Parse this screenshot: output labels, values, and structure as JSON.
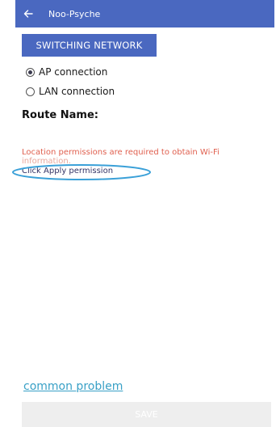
{
  "app_bar": {
    "title": "Noo-Psyche",
    "back_icon": "arrow-left-icon",
    "color": "#4a68c0"
  },
  "switch_button": {
    "label": "SWITCHING NETWORK"
  },
  "connection_options": [
    {
      "label": "AP connection",
      "selected": true
    },
    {
      "label": "LAN connection",
      "selected": false
    }
  ],
  "route": {
    "label": "Route Name:"
  },
  "permission": {
    "message_line1": "Location permissions are required to obtain Wi-Fi",
    "message_line2": "information.",
    "link": "Click Apply permission",
    "message_color": "#e0604f",
    "highlight_color": "#3aa0d8"
  },
  "common_problem": {
    "label": "common problem",
    "color": "#38a0c6"
  },
  "save_button": {
    "label": "SAVE",
    "background": "#eeeeee"
  }
}
